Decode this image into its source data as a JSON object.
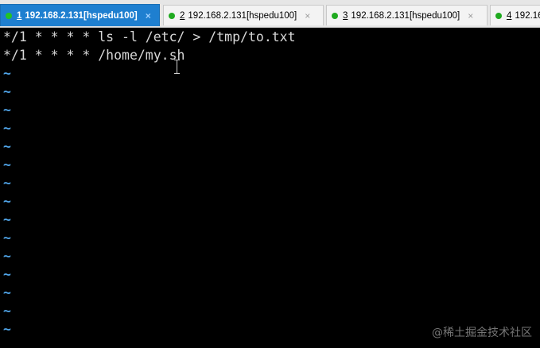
{
  "tabs": [
    {
      "number": "1",
      "title": "192.168.2.131[hspedu100]",
      "active": true,
      "close": "×"
    },
    {
      "number": "2",
      "title": "192.168.2.131[hspedu100]",
      "active": false,
      "close": "×"
    },
    {
      "number": "3",
      "title": "192.168.2.131[hspedu100]",
      "active": false,
      "close": "×"
    },
    {
      "number": "4",
      "title": "192.16",
      "active": false
    }
  ],
  "terminal": {
    "lines": [
      "*/1 * * * * ls -l /etc/ > /tmp/to.txt",
      "*/1 * * * * /home/my.sh"
    ],
    "empty_line_marker": "~"
  },
  "watermark": "@稀土掘金技术社区",
  "colors": {
    "background": "#000000",
    "text": "#d8d8d8",
    "tilde": "#4fa3e6",
    "active_tab": "#1e7fd0",
    "status_dot": "#1faa1f"
  }
}
